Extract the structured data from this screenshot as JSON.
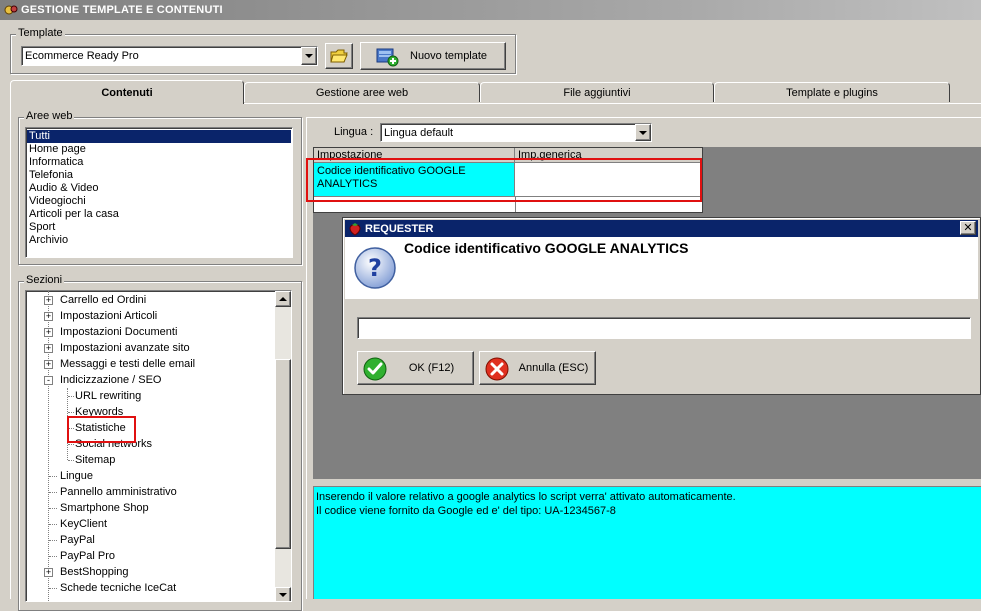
{
  "window": {
    "title": "GESTIONE TEMPLATE E CONTENUTI"
  },
  "template_group": {
    "label": "Template",
    "selected": "Ecommerce Ready Pro",
    "new_button": "Nuovo template"
  },
  "tabs": [
    {
      "label": "Contenuti",
      "active": true
    },
    {
      "label": "Gestione aree web"
    },
    {
      "label": "File aggiuntivi"
    },
    {
      "label": "Template e plugins"
    }
  ],
  "aree_web": {
    "label": "Aree web",
    "items": [
      "Tutti",
      "Home page",
      "Informatica",
      "Telefonia",
      "Audio & Video",
      "Videogiochi",
      "Articoli per la casa",
      "Sport",
      "Archivio"
    ],
    "selected_index": 0
  },
  "sezioni": {
    "label": "Sezioni",
    "items": [
      {
        "label": "Carrello ed Ordini",
        "level": 0,
        "expander": "+"
      },
      {
        "label": "Impostazioni Articoli",
        "level": 0,
        "expander": "+"
      },
      {
        "label": "Impostazioni Documenti",
        "level": 0,
        "expander": "+"
      },
      {
        "label": "Impostazioni avanzate sito",
        "level": 0,
        "expander": "+"
      },
      {
        "label": "Messaggi e testi delle email",
        "level": 0,
        "expander": "+"
      },
      {
        "label": "Indicizzazione / SEO",
        "level": 0,
        "expander": "-"
      },
      {
        "label": "URL rewriting",
        "level": 1
      },
      {
        "label": "Keywords",
        "level": 1
      },
      {
        "label": "Statistiche",
        "level": 1,
        "highlighted": true
      },
      {
        "label": "Social networks",
        "level": 1
      },
      {
        "label": "Sitemap",
        "level": 1
      },
      {
        "label": "Lingue",
        "level": 0
      },
      {
        "label": "Pannello amministrativo",
        "level": 0
      },
      {
        "label": "Smartphone Shop",
        "level": 0
      },
      {
        "label": "KeyClient",
        "level": 0
      },
      {
        "label": "PayPal",
        "level": 0
      },
      {
        "label": "PayPal Pro",
        "level": 0
      },
      {
        "label": "BestShopping",
        "level": 0,
        "expander": "+"
      },
      {
        "label": "Schede tecniche IceCat",
        "level": 0
      }
    ]
  },
  "lingua": {
    "label": "Lingua :",
    "selected": "Lingua default"
  },
  "grid": {
    "columns": [
      "Impostazione",
      "Imp.generica"
    ],
    "rows": [
      {
        "impostazione": "Codice identificativo GOOGLE ANALYTICS",
        "generica": ""
      }
    ]
  },
  "requester": {
    "title": "REQUESTER",
    "question": "Codice identificativo GOOGLE ANALYTICS",
    "input_value": "",
    "ok_label": "OK (F12)",
    "cancel_label": "Annulla (ESC)"
  },
  "description": {
    "lines": [
      "Inserendo il valore relativo a google analytics lo script verra' attivato automaticamente.",
      "Il codice viene fornito da Google ed e' del tipo: UA-1234567-8"
    ]
  },
  "colors": {
    "highlight_cyan": "#00ffff",
    "selection_blue": "#0a246a",
    "annotation_red": "#e01010",
    "dialog_title_bg": "#0a246a",
    "panel_gray": "#808080"
  }
}
